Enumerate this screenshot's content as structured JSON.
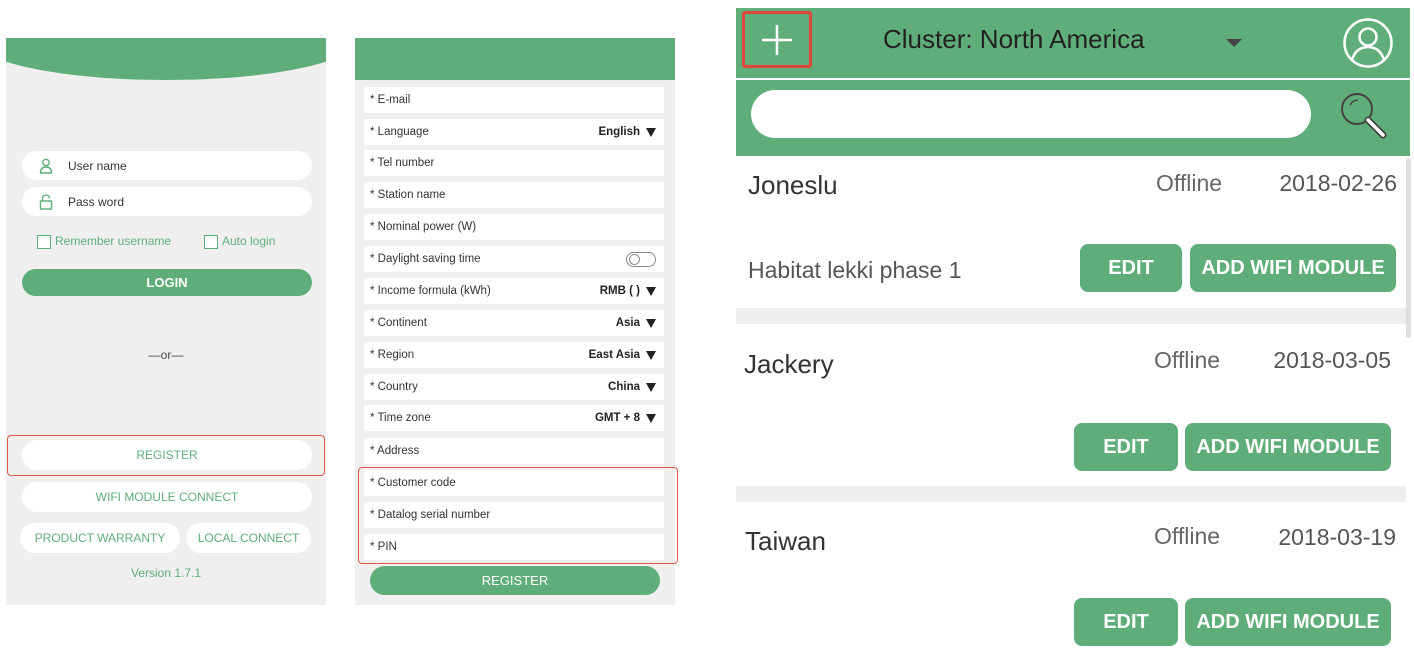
{
  "login": {
    "username_placeholder": "User name",
    "password_placeholder": "Pass word",
    "remember_label": "Remember username",
    "autologin_label": "Auto login",
    "login_button": "LOGIN",
    "or_text": "—or—",
    "register_button": "REGISTER",
    "wifi_button": "WIFI MODULE CONNECT",
    "warranty_button": "PRODUCT WARRANTY",
    "local_button": "LOCAL CONNECT",
    "version": "Version 1.7.1"
  },
  "register": {
    "fields": {
      "email": "* E-mail",
      "language": "* Language",
      "tel": "* Tel number",
      "station": "* Station name",
      "power": "* Nominal power (W)",
      "daylight": "* Daylight saving time",
      "income": "* Income formula (kWh)",
      "continent": "* Continent",
      "region": "* Region",
      "country": "* Country",
      "timezone": "* Time zone",
      "address": "* Address",
      "customer": "* Customer code",
      "datalog": "* Datalog serial number",
      "pin": "* PIN"
    },
    "values": {
      "language": "English",
      "income": "RMB ( )",
      "continent": "Asia",
      "region": "East Asia",
      "country": "China",
      "timezone": "GMT + 8"
    },
    "submit": "REGISTER"
  },
  "stations": {
    "cluster": "Cluster: North America",
    "search_value": "",
    "edit_label": "EDIT",
    "add_wifi_label": "ADD WIFI MODULE",
    "items": [
      {
        "name": "Joneslu",
        "status": "Offline",
        "date": "2018-02-26",
        "sub": "Habitat lekki phase 1"
      },
      {
        "name": "Jackery",
        "status": "Offline",
        "date": "2018-03-05",
        "sub": ""
      },
      {
        "name": "Taiwan",
        "status": "Offline",
        "date": "2018-03-19",
        "sub": ""
      }
    ]
  },
  "colors": {
    "accent": "#5fae7a",
    "highlight": "#e0584a"
  }
}
